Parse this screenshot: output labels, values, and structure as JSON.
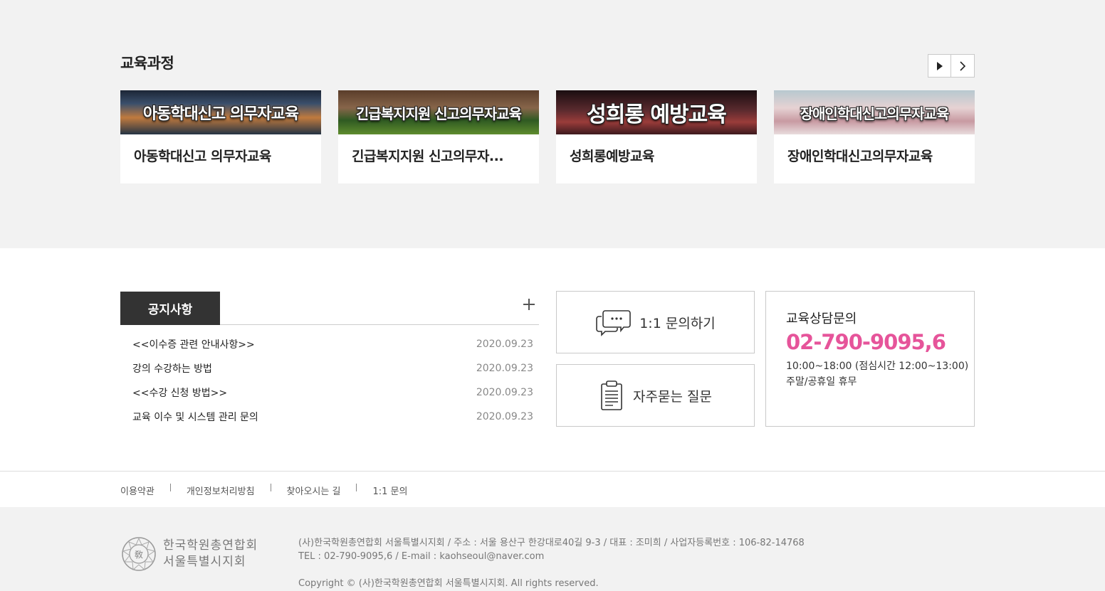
{
  "courses": {
    "title": "교육과정",
    "items": [
      {
        "banner": "아동학대신고 의무자교육",
        "name": "아동학대신고 의무자교육"
      },
      {
        "banner": "긴급복지지원 신고의무자교육",
        "name": "긴급복지지원 신고의무자..."
      },
      {
        "banner": "성희롱 예방교육",
        "name": "성희롱예방교육"
      },
      {
        "banner": "장애인학대신고의무자교육",
        "name": "장애인학대신고의무자교육"
      }
    ]
  },
  "notice": {
    "title": "공지사항",
    "items": [
      {
        "title": "<<이수증 관련 안내사항>>",
        "date": "2020.09.23"
      },
      {
        "title": "강의 수강하는 방법",
        "date": "2020.09.23"
      },
      {
        "title": "<<수강 신청 방법>>",
        "date": "2020.09.23"
      },
      {
        "title": "교육 이수 및 시스템 관리 문의",
        "date": "2020.09.23"
      }
    ]
  },
  "inquiry": {
    "label": "1:1 문의하기"
  },
  "faq": {
    "label": "자주묻는 질문"
  },
  "consult": {
    "title": "교육상담문의",
    "phone": "02-790-9095,6",
    "hours": "10:00~18:00 (점심시간 12:00~13:00)",
    "closed": "주말/공휴일 휴무"
  },
  "footer_links": [
    "이용약관",
    "개인정보처리방침",
    "찾아오시는 길",
    "1:1 문의"
  ],
  "footer": {
    "logo_line1": "한국학원총연합회",
    "logo_line2": "서울특별시지회",
    "info1": "(사)한국학원총연합회 서울특별시지회 / 주소 : 서울 용산구 한강대로40길 9-3 / 대표 : 조미희 / 사업자등록번호 : 106-82-14768",
    "info2": "TEL : 02-790-9095,6 / E-mail : kaohseoul@naver.com",
    "copyright": "Copyright © (사)한국학원총연합회 서울특별시지회. All rights reserved."
  },
  "colors": {
    "accent": "#e6549a",
    "tab_bg": "#333333"
  },
  "icons": [
    "play-icon",
    "chevron-right-icon",
    "plus-icon",
    "chat-bubbles-icon",
    "clipboard-icon",
    "emblem-logo"
  ]
}
